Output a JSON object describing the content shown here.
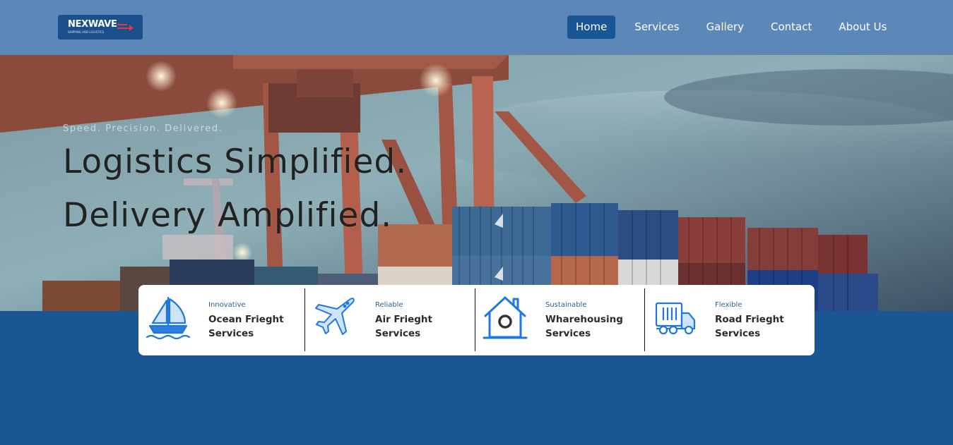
{
  "brand": {
    "name": "NEXWAVE",
    "tagline_small": "SHIPPING AND LOGISTICS",
    "accent_color": "#e03a3e",
    "primary_color": "#1a5694",
    "header_color": "#5b88b8"
  },
  "nav": {
    "items": [
      {
        "label": "Home",
        "active": true
      },
      {
        "label": "Services",
        "active": false
      },
      {
        "label": "Gallery",
        "active": false
      },
      {
        "label": "Contact",
        "active": false
      },
      {
        "label": "About Us",
        "active": false
      }
    ]
  },
  "hero": {
    "tagline": "Speed. Precision. Delivered.",
    "headline_line1": "Logistics Simplified.",
    "headline_line2": "Delivery Amplified."
  },
  "services": [
    {
      "icon": "sailboat-icon",
      "subtitle": "Innovative",
      "title": "Ocean Frieght Services"
    },
    {
      "icon": "airplane-icon",
      "subtitle": "Reliable",
      "title": "Air Frieght Services"
    },
    {
      "icon": "warehouse-icon",
      "subtitle": "Sustainable",
      "title": "Wharehousing Services"
    },
    {
      "icon": "truck-icon",
      "subtitle": "Flexible",
      "title": "Road Frieght Services"
    }
  ]
}
